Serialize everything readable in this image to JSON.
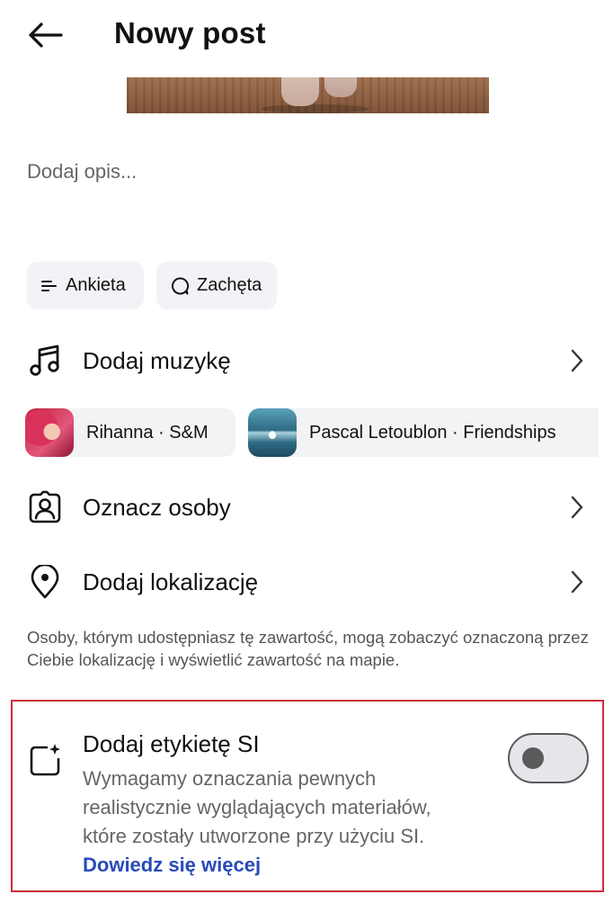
{
  "header": {
    "title": "Nowy post"
  },
  "caption": {
    "placeholder": "Dodaj opis..."
  },
  "chips": {
    "poll_label": "Ankieta",
    "prompt_label": "Zachęta"
  },
  "rows": {
    "music_label": "Dodaj muzykę",
    "tag_people_label": "Oznacz osoby",
    "location_label": "Dodaj lokalizację"
  },
  "music_suggestions": [
    {
      "label": "Rihanna · S&M"
    },
    {
      "label": "Pascal Letoublon · Friendships"
    }
  ],
  "location_info": "Osoby, którym udostępniasz tę zawartość, mogą zobaczyć oznaczoną przez Ciebie lokalizację i wyświetlić zawartość na mapie.",
  "ai_label": {
    "title": "Dodaj etykietę SI",
    "description": "Wymagamy oznaczania pewnych realistycznie wyglądających materiałów, które zostały utworzone przy użyciu SI.",
    "link": "Dowiedz się więcej",
    "toggle_on": false
  },
  "colors": {
    "link": "#2a4bb8",
    "highlight_border": "#cc2e3b",
    "chip_bg": "#f1f3f6"
  },
  "icons": [
    "back-arrow-icon",
    "poll-icon",
    "prompt-icon",
    "music-note-icon",
    "chevron-right-icon",
    "tag-person-icon",
    "location-pin-icon",
    "ai-sparkle-icon"
  ]
}
